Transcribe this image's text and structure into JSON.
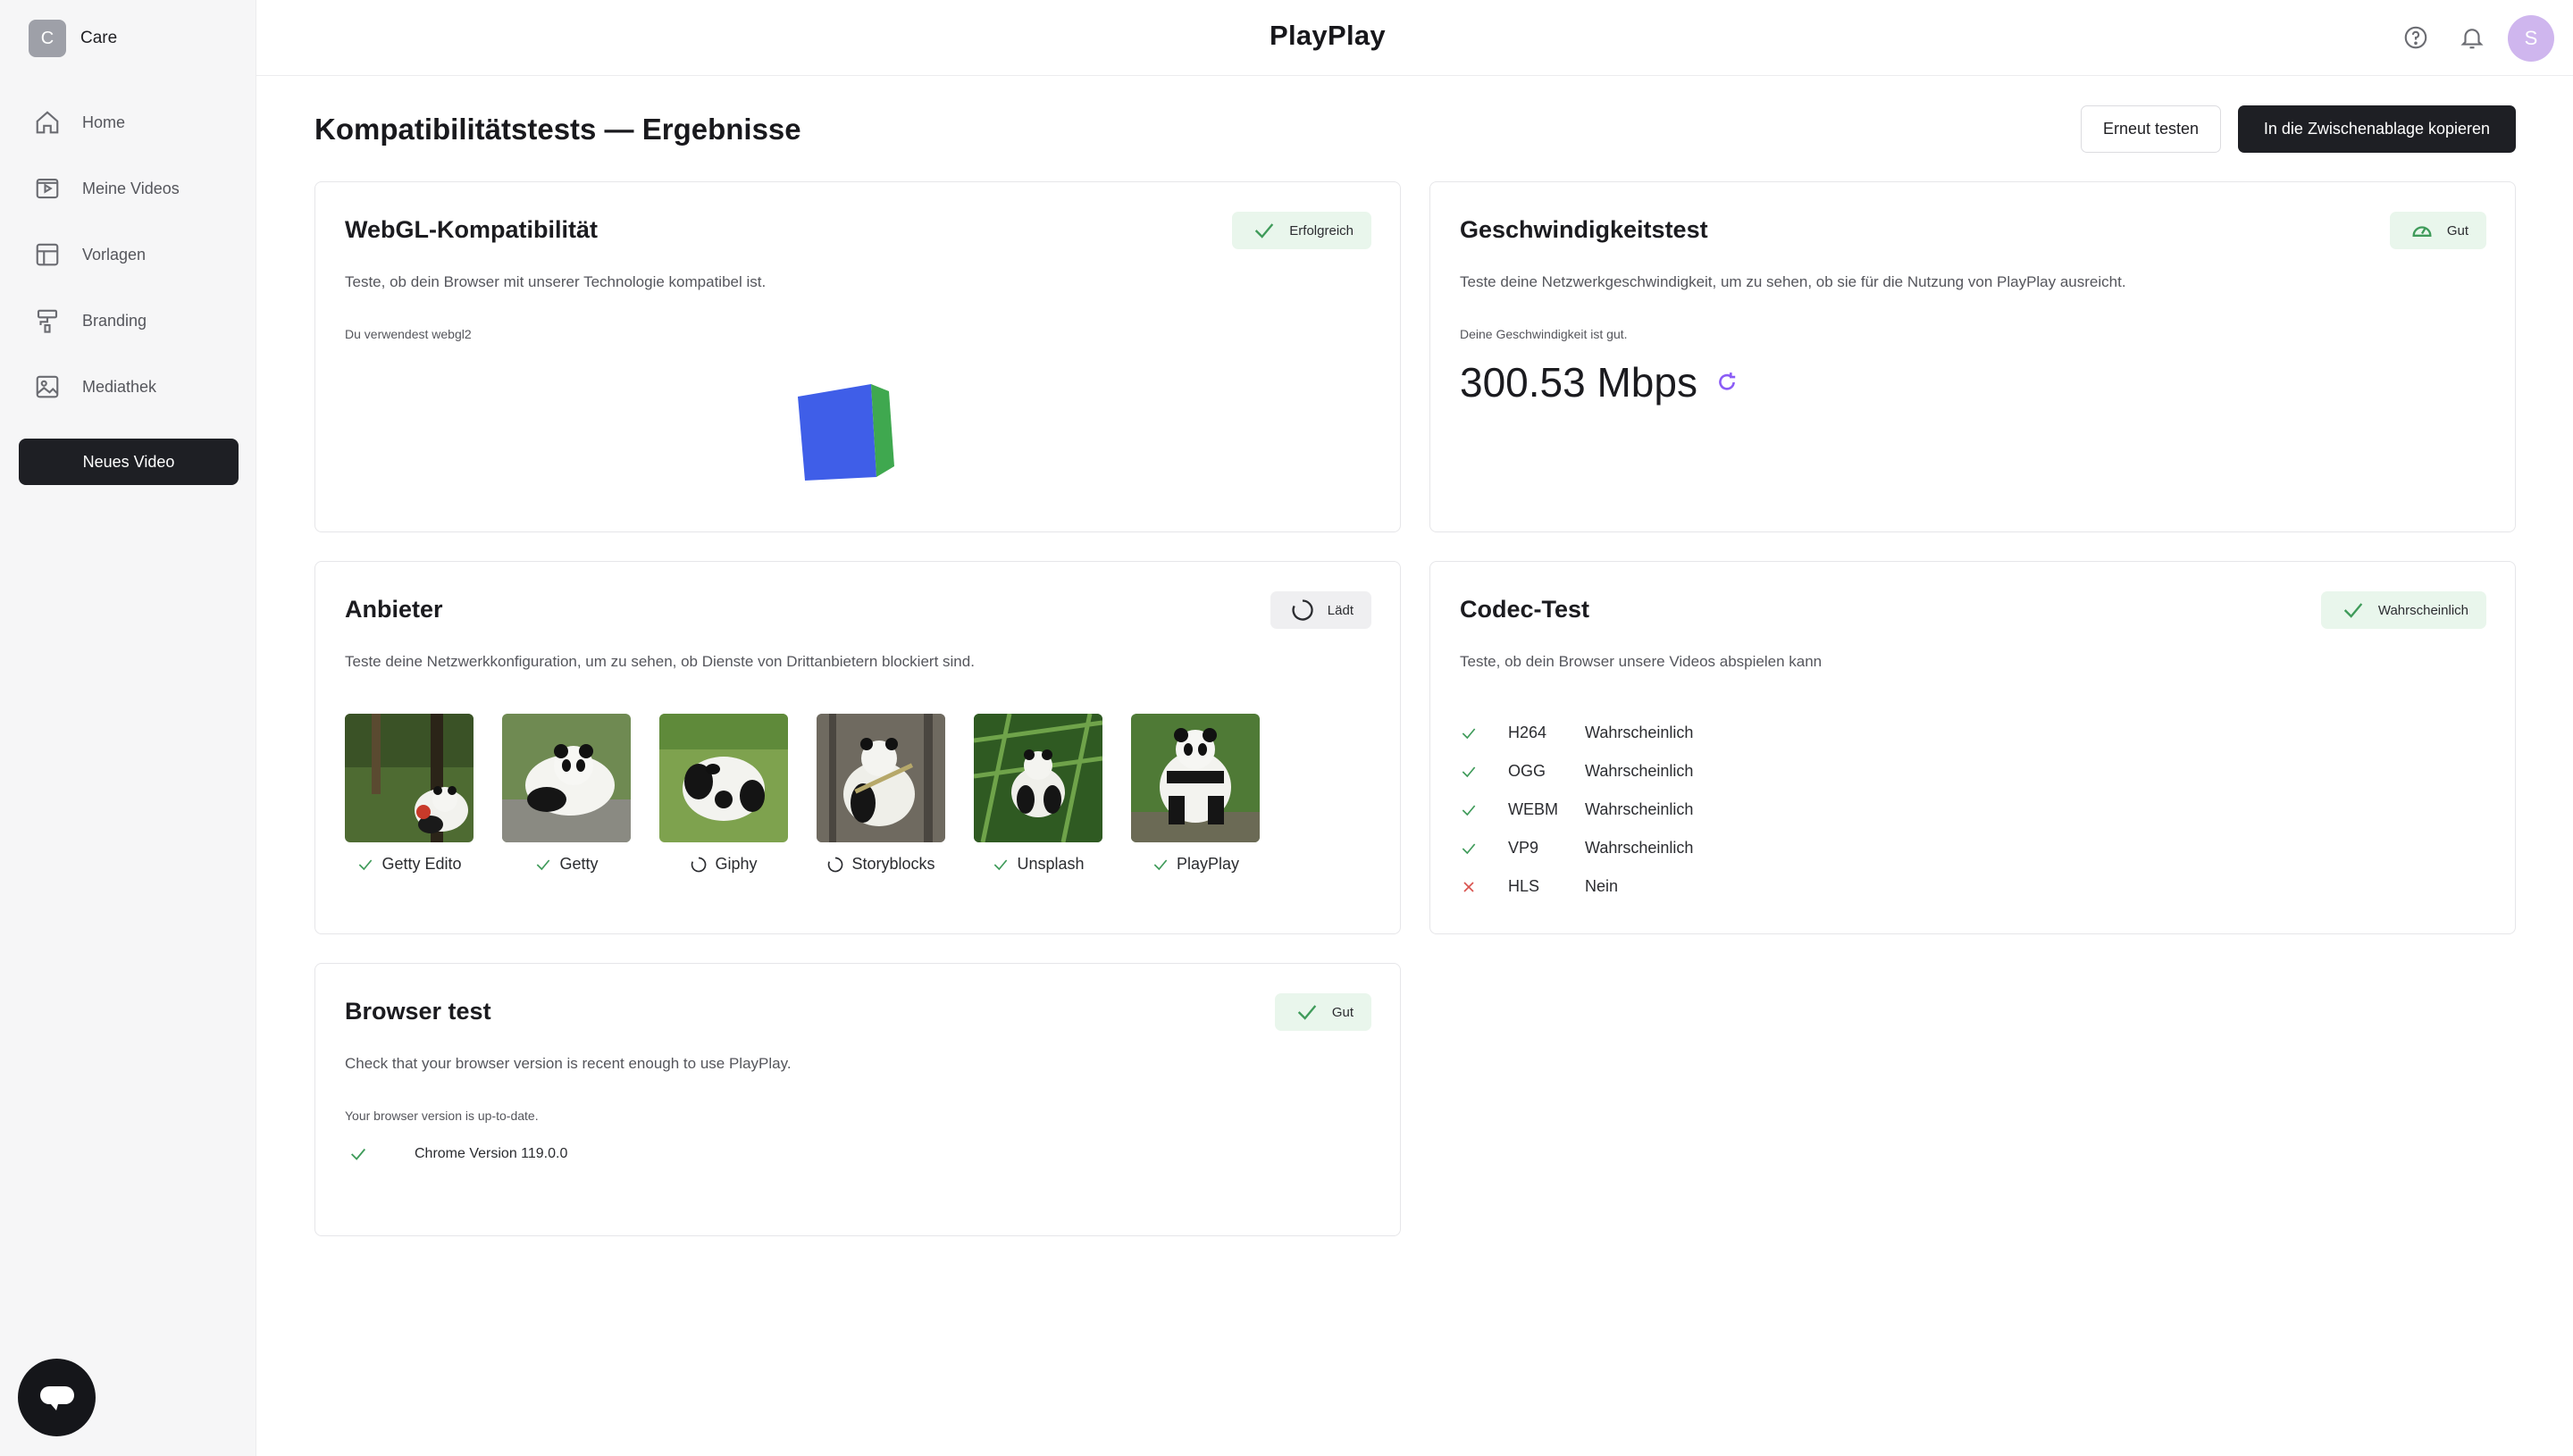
{
  "workspace": {
    "initial": "C",
    "name": "Care"
  },
  "nav": [
    {
      "label": "Home",
      "icon": "home-icon"
    },
    {
      "label": "Meine Videos",
      "icon": "video-icon"
    },
    {
      "label": "Vorlagen",
      "icon": "template-icon"
    },
    {
      "label": "Branding",
      "icon": "paint-roller-icon"
    },
    {
      "label": "Mediathek",
      "icon": "media-library-icon"
    }
  ],
  "new_video_label": "Neues Video",
  "header": {
    "logo": "PlayPlay",
    "avatar_initial": "S"
  },
  "page": {
    "title": "Kompatibilitätstests — Ergebnisse",
    "retest_label": "Erneut testen",
    "copy_label": "In die Zwischenablage kopieren"
  },
  "webgl": {
    "title": "WebGL-Kompatibilität",
    "badge": "Erfolgreich",
    "description": "Teste, ob dein Browser mit unserer Technologie kompatibel ist.",
    "note": "Du verwendest webgl2"
  },
  "speed": {
    "title": "Geschwindigkeitstest",
    "badge": "Gut",
    "description": "Teste deine Netzwerkgeschwindigkeit, um zu sehen, ob sie für die Nutzung von PlayPlay ausreicht.",
    "note": "Deine Geschwindigkeit ist gut.",
    "value": "300.53 Mbps"
  },
  "providers": {
    "title": "Anbieter",
    "badge": "Lädt",
    "description": "Teste deine Netzwerkkonfiguration, um zu sehen, ob Dienste von Drittanbietern blockiert sind.",
    "items": [
      {
        "name": "Getty Edito",
        "status": "ok"
      },
      {
        "name": "Getty",
        "status": "ok"
      },
      {
        "name": "Giphy",
        "status": "loading"
      },
      {
        "name": "Storyblocks",
        "status": "loading"
      },
      {
        "name": "Unsplash",
        "status": "ok"
      },
      {
        "name": "PlayPlay",
        "status": "ok"
      }
    ]
  },
  "codec": {
    "title": "Codec-Test",
    "badge": "Wahrscheinlich",
    "description": "Teste, ob dein Browser unsere Videos abspielen kann",
    "items": [
      {
        "name": "H264",
        "result": "Wahrscheinlich",
        "ok": true
      },
      {
        "name": "OGG",
        "result": "Wahrscheinlich",
        "ok": true
      },
      {
        "name": "WEBM",
        "result": "Wahrscheinlich",
        "ok": true
      },
      {
        "name": "VP9",
        "result": "Wahrscheinlich",
        "ok": true
      },
      {
        "name": "HLS",
        "result": "Nein",
        "ok": false
      }
    ]
  },
  "browser": {
    "title": "Browser test",
    "badge": "Gut",
    "description": "Check that your browser version is recent enough to use PlayPlay.",
    "note": "Your browser version is up-to-date.",
    "version": "Chrome Version 119.0.0"
  },
  "colors": {
    "success": "#3f9b5a",
    "error": "#d9534f",
    "accent_purple": "#8b5cf6",
    "dark": "#1e1f24",
    "cube_blue": "#3f5ee8",
    "cube_green": "#3fa84f"
  }
}
